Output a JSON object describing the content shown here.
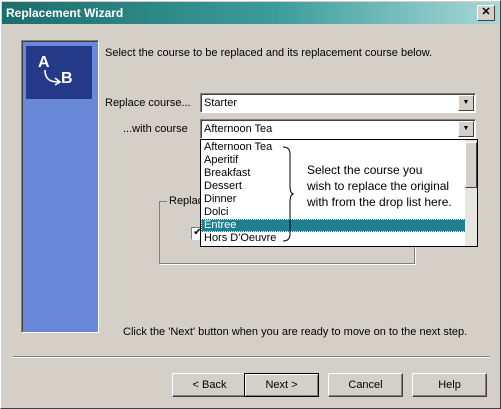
{
  "window": {
    "title": "Replacement Wizard",
    "close_glyph": "✕"
  },
  "side_panel": {
    "logo_letter_a": "A",
    "logo_letter_b": "B",
    "logo_icon": "arrow-swap-icon"
  },
  "instruction": "Select the course to be replaced and its replacement course below.",
  "replace": {
    "label": "Replace course...",
    "value": "Starter"
  },
  "with": {
    "label": "...with course",
    "value": "Afternoon Tea",
    "options": [
      "Afternoon Tea",
      "Aperitif",
      "Breakfast",
      "Dessert",
      "Dinner",
      "Dolci",
      "Entree",
      "Hors D'Oeuvre"
    ],
    "selected_index": 6,
    "scroll_icon": "scrollbar-thumb"
  },
  "group": {
    "label": "Replac",
    "checked": true,
    "check_glyph": "✔"
  },
  "callout": "Select the course you\nwish to replace the original\nwith from the drop list here.",
  "footer_text": "Click the 'Next' button when you are ready to move on to the next step.",
  "buttons": {
    "back": "< Back",
    "next": "Next >",
    "cancel": "Cancel",
    "help": "Help"
  },
  "colors": {
    "selection": "#1f7f8f",
    "panel": "#6a88d8",
    "title_start": "#1d6d6d"
  }
}
